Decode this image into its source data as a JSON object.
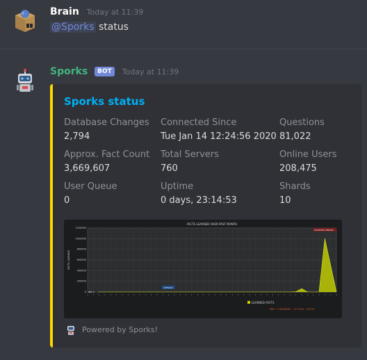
{
  "messages": [
    {
      "author": "Brain",
      "timestamp": "Today at 11:39",
      "mention": "@Sporks",
      "text": "status"
    },
    {
      "author": "Sporks",
      "badge": "BOT",
      "timestamp": "Today at 11:39"
    }
  ],
  "embed": {
    "title": "Sporks status",
    "accent_color": "#ffd700",
    "fields": [
      {
        "name": "Database Changes",
        "value": "2,794"
      },
      {
        "name": "Connected Since",
        "value": "Tue Jan 14 12:24:56 2020"
      },
      {
        "name": "Questions",
        "value": "81,022"
      },
      {
        "name": "Approx. Fact Count",
        "value": "3,669,607"
      },
      {
        "name": "Total Servers",
        "value": "760"
      },
      {
        "name": "Online Users",
        "value": "208,475"
      },
      {
        "name": "User Queue",
        "value": "0"
      },
      {
        "name": "Uptime",
        "value": "0 days, 23:14:53"
      },
      {
        "name": "Shards",
        "value": "10"
      }
    ],
    "footer": "Powered by Sporks!"
  },
  "chart_data": {
    "type": "area",
    "title": "FACTS LEARNED OVER PAST MONTH",
    "ylabel": "FACTS LEARNED",
    "ylim": [
      0,
      1200000
    ],
    "y_ticks": [
      "0",
      "200000",
      "400000",
      "600000",
      "800000",
      "1000000",
      "1200000"
    ],
    "series": [
      {
        "name": "LEARNED FACTS",
        "color": "#c8d400",
        "values": [
          0,
          0,
          0,
          0,
          0,
          0,
          0,
          0,
          0,
          0,
          0,
          0,
          0,
          0,
          0,
          0,
          0,
          0,
          0,
          0,
          0,
          0,
          0,
          0,
          0,
          0,
          0,
          0,
          0,
          0,
          0,
          0,
          0,
          0,
          0,
          0,
          5000,
          60000,
          0,
          0,
          0,
          1000000,
          500000,
          0
        ]
      }
    ],
    "annotations": [
      {
        "text": "MIN: 0",
        "index": 0
      },
      {
        "text": "AVERAGE",
        "index": 13
      },
      {
        "text": "MAXIMUM 1080000",
        "index": 41
      }
    ],
    "stats_text": "MIN : 0   AVERAGE : 127   AVG : 23105"
  },
  "colors": {
    "background": "#36393f",
    "bot_username": "#43b581",
    "user_username": "#ffffff",
    "title_link": "#00b0f4"
  },
  "icons": {
    "brain_avatar": "cardboard-box-brain",
    "sporks_avatar": "robot",
    "footer_icon": "robot"
  }
}
